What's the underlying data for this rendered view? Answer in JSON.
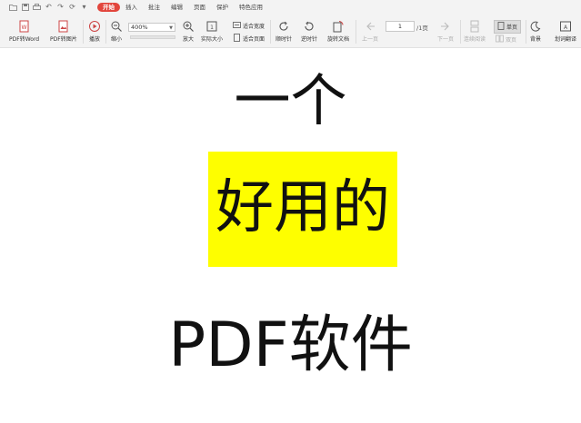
{
  "quick_access": {
    "icons": [
      "folder-icon",
      "save-icon",
      "print-icon",
      "undo-icon",
      "redo-icon",
      "refresh-icon",
      "dropdown-icon"
    ]
  },
  "menu_tabs": [
    {
      "label": "开始",
      "active": true
    },
    {
      "label": "插入",
      "active": false
    },
    {
      "label": "批注",
      "active": false
    },
    {
      "label": "编辑",
      "active": false
    },
    {
      "label": "页面",
      "active": false
    },
    {
      "label": "保护",
      "active": false
    },
    {
      "label": "特色应用",
      "active": false
    }
  ],
  "ribbon": {
    "pdf_to_word": "PDF转Word",
    "pdf_to_image": "PDF转图片",
    "play": "播放",
    "zoom_out": "缩小",
    "zoom_value": "400%",
    "zoom_in": "放大",
    "actual_size": "实际大小",
    "fit_width": "适合宽度",
    "fit_page": "适合页面",
    "rotate_cw": "顺时针",
    "rotate_ccw": "逆时针",
    "rotate_doc": "旋转文档",
    "prev_page": "上一页",
    "page_current": "1",
    "page_total": "/1页",
    "next_page": "下一页",
    "continuous_read": "连续阅读",
    "two_page": "双页",
    "single_page": "单页",
    "background": "背景",
    "translate": "划词翻译"
  },
  "document": {
    "line1": "一个",
    "line2": "好用的",
    "line3": "PDF软件"
  },
  "colors": {
    "accent": "#e2453c",
    "highlight": "#fefe00",
    "toolbar_bg": "#f3f3f3"
  }
}
